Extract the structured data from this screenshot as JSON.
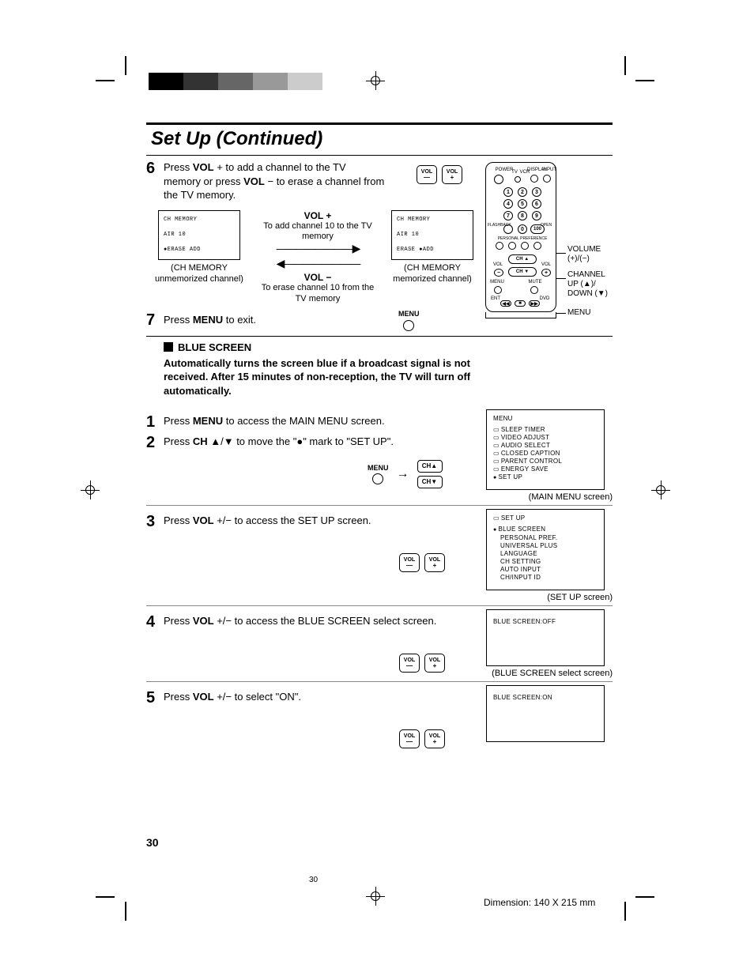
{
  "title": "Set Up (Continued)",
  "step6": {
    "num": "6",
    "text_a": "Press ",
    "text_b": "VOL",
    "text_c": " + to add a channel to the TV memory or press ",
    "text_d": "VOL",
    "text_e": " − to erase a channel from the TV memory."
  },
  "vol_plus_label": "VOL +",
  "vol_plus_desc": "To add channel 10 to the TV memory",
  "vol_minus_label": "VOL −",
  "vol_minus_desc": "To erase channel 10 from the TV memory",
  "tv_left": {
    "l1": "CH MEMORY",
    "l2": "AIR 10",
    "l3": "●ERASE    ADD"
  },
  "tv_left_cap": "(CH MEMORY\nunmemorized channel)",
  "tv_right": {
    "l1": "CH MEMORY",
    "l2": "AIR 10",
    "l3": "ERASE    ●ADD"
  },
  "tv_right_cap": "(CH MEMORY\nmemorized channel)",
  "vol_btn_minus": "VOL\n—",
  "vol_btn_plus": "VOL\n+",
  "menu_btn": "MENU",
  "step7": {
    "num": "7",
    "a": "Press ",
    "b": "MENU",
    "c": " to exit."
  },
  "blue_hdr": "BLUE SCREEN",
  "blue_desc": "Automatically turns the screen blue if a broadcast signal is not received. After 15 minutes of non-reception, the TV will turn off automatically.",
  "step1": {
    "num": "1",
    "a": "Press ",
    "b": "MENU",
    "c": " to access the MAIN MENU screen."
  },
  "step2": {
    "num": "2",
    "a": "Press ",
    "b": "CH",
    "c": " ▲/▼ to move the \"●\" mark to \"SET UP\"."
  },
  "ch_up": "CH▲",
  "ch_down": "CH▼",
  "mainmenu": {
    "hdr": "MENU",
    "items": [
      "SLEEP TIMER",
      "VIDEO ADJUST",
      "AUDIO SELECT",
      "CLOSED CAPTION",
      "PARENT CONTROL",
      "ENERGY SAVE",
      "SET UP"
    ],
    "cap": "(MAIN MENU screen)"
  },
  "step3": {
    "num": "3",
    "a": "Press ",
    "b": "VOL",
    "c": " +/− to access the SET UP screen."
  },
  "setup": {
    "hdr": "SET UP",
    "items": [
      "BLUE SCREEN",
      "PERSONAL PREF.",
      "UNIVERSAL PLUS",
      "LANGUAGE",
      "CH SETTING",
      "AUTO INPUT",
      "CH/INPUT ID"
    ],
    "cap": "(SET UP screen)"
  },
  "step4": {
    "num": "4",
    "a": "Press ",
    "b": "VOL",
    "c": " +/− to access the BLUE SCREEN select screen."
  },
  "bluesel": {
    "line": "BLUE SCREEN:OFF",
    "cap": "(BLUE SCREEN select screen)"
  },
  "step5": {
    "num": "5",
    "a": "Press ",
    "b": "VOL",
    "c": " +/− to select \"ON\"."
  },
  "blueon": {
    "line": "BLUE SCREEN:ON"
  },
  "remote_labels": {
    "power": "POWER",
    "tv": "TV",
    "vcr": "VCR",
    "display": "DISPLAY",
    "input": "INPUT",
    "flashback": "FLASHBACK",
    "open": "OPEN",
    "pp": "PERSONAL PREFERENCE",
    "ch": "CH",
    "vol": "VOL",
    "menu": "MENU",
    "mute": "MUTE",
    "ent": "ENT",
    "dvd": "DVD"
  },
  "remote_callouts": {
    "volume": "VOLUME\n(+)/(−)",
    "channel": "CHANNEL\nUP (▲)/\nDOWN (▼)",
    "menu": "MENU"
  },
  "page_bold": "30",
  "page_small": "30",
  "dimension": "Dimension: 140  X 215 mm"
}
